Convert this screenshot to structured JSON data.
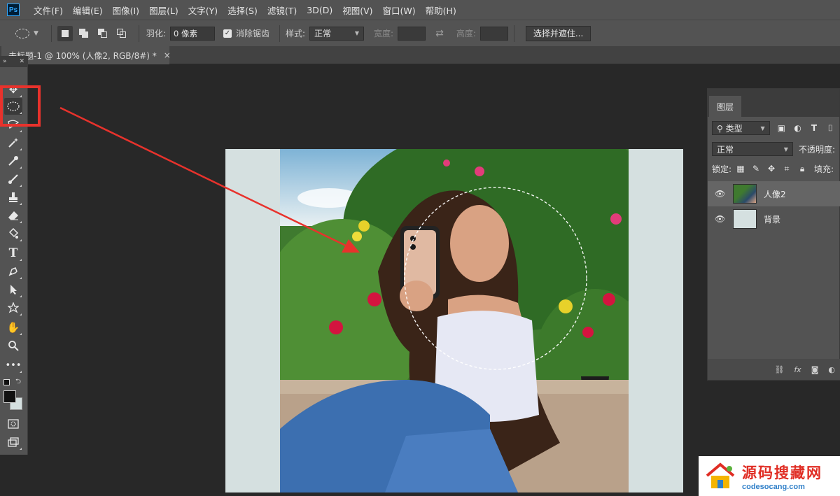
{
  "app": {
    "logo": "Ps"
  },
  "menu": [
    "文件(F)",
    "编辑(E)",
    "图像(I)",
    "图层(L)",
    "文字(Y)",
    "选择(S)",
    "滤镜(T)",
    "3D(D)",
    "视图(V)",
    "窗口(W)",
    "帮助(H)"
  ],
  "options": {
    "feather_label": "羽化:",
    "feather_value": "0 像素",
    "antialias_label": "消除锯齿",
    "style_label": "样式:",
    "style_value": "正常",
    "width_label": "宽度:",
    "height_label": "高度:",
    "select_mask_button": "选择并遮住..."
  },
  "document_tab": {
    "title": "未标题-1 @ 100% (人像2, RGB/8#) *",
    "close": "×"
  },
  "toolbox": {
    "tools": [
      "move-tool",
      "elliptical-marquee-tool",
      "lasso-tool",
      "magic-wand-tool",
      "eyedropper-tool",
      "brush-tool",
      "clone-stamp-tool",
      "eraser-tool",
      "paint-bucket-tool",
      "type-tool",
      "pen-tool",
      "path-selection-tool",
      "shape-tool",
      "hand-tool",
      "zoom-tool",
      "more-tools"
    ],
    "active_tool": "elliptical-marquee-tool",
    "foreground_color": "#111111",
    "background_color": "#d5e0e0"
  },
  "layers_panel": {
    "tab_label": "图层",
    "filter_label": "类型",
    "blend_mode": "正常",
    "opacity_label": "不透明度:",
    "lock_label": "锁定:",
    "fill_label": "填充:",
    "layers": [
      {
        "name": "人像2",
        "visible": true,
        "selected": true
      },
      {
        "name": "背景",
        "visible": true,
        "selected": false
      }
    ]
  },
  "annotation": {
    "highlight_color": "#e8322c"
  },
  "watermark": {
    "title": "源码搜藏网",
    "url": "codesocang.com"
  }
}
